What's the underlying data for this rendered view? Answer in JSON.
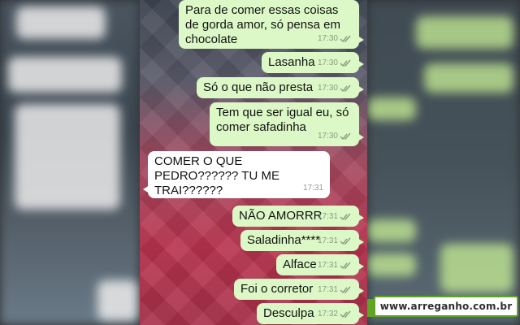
{
  "messages": [
    {
      "text": "Para de comer essas coisas\nde gorda amor, só pensa em\nchocolate",
      "time": "17:30",
      "dir": "out"
    },
    {
      "text": "Lasanha",
      "time": "17:30",
      "dir": "out"
    },
    {
      "text": "Só o que não presta",
      "time": "17:30",
      "dir": "out"
    },
    {
      "text": "Tem que ser igual eu, só\ncomer safadinha",
      "time": "17:30",
      "dir": "out"
    },
    {
      "text": "COMER O QUE\nPEDRO?????? TU ME\nTRAI??????",
      "time": "17:31",
      "dir": "in"
    },
    {
      "text": "NÃO AMORRR",
      "time": "17:31",
      "dir": "out"
    },
    {
      "text": "Saladinha****",
      "time": "17:31",
      "dir": "out"
    },
    {
      "text": "Alface",
      "time": "17:31",
      "dir": "out"
    },
    {
      "text": "Foi o corretor",
      "time": "17:31",
      "dir": "out"
    },
    {
      "text": "Desculpa",
      "time": "17:32",
      "dir": "out"
    }
  ],
  "watermark": {
    "text": "www.arreganho.com.br"
  },
  "colors": {
    "outgoing_bubble": "#dcf8c6",
    "incoming_bubble": "#ffffff",
    "watermark_green": "#5ea524"
  },
  "icons": {
    "read_receipt": "double-check-icon"
  }
}
